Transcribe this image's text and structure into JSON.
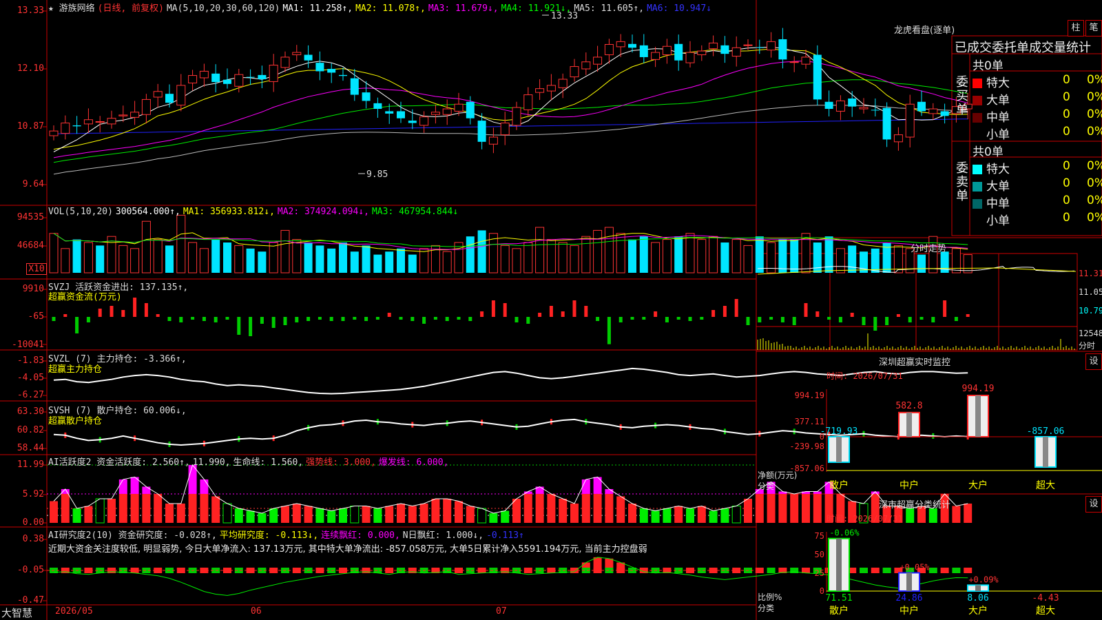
{
  "stock": {
    "name": "★ 游族网络",
    "period": "(日线, 前复权)",
    "ma_items": [
      {
        "t": "MA(5,10,20,30,60,120)",
        "c": "#dddddd"
      },
      {
        "t": "MA1: 11.258↑,",
        "c": "#ffffff"
      },
      {
        "t": "MA2: 11.078↑,",
        "c": "#ffff00"
      },
      {
        "t": "MA3: 11.679↓,",
        "c": "#ff00ff"
      },
      {
        "t": "MA4: 11.921↓,",
        "c": "#00ff00"
      },
      {
        "t": "MA5: 11.605↑,",
        "c": "#dddddd"
      },
      {
        "t": "MA6: 10.947↓",
        "c": "#3333ff"
      }
    ],
    "y_labels": [
      "13.33",
      "12.10",
      "10.87",
      "9.64"
    ],
    "high_label": "13.33",
    "low_label": "9.85"
  },
  "volume": {
    "items": [
      {
        "t": "VOL(5,10,20)",
        "c": "#dddddd"
      },
      {
        "t": "300564.000↑,",
        "c": "#ffffff"
      },
      {
        "t": "MA1: 356933.812↓,",
        "c": "#ffff00"
      },
      {
        "t": "MA2: 374924.094↓,",
        "c": "#ff00ff"
      },
      {
        "t": "MA3: 467954.844↓",
        "c": "#00ff00"
      }
    ],
    "y_labels": [
      "94535",
      "46684"
    ],
    "unit": "X10"
  },
  "svzj": {
    "line1": "SVZJ  活跃资金进出: 137.135↑,",
    "line2": "超赢资金流(万元)",
    "y_labels": [
      "9910",
      "-65",
      "-10041"
    ]
  },
  "svzl": {
    "line1": "SVZL (7) 主力持仓: -3.366↑,",
    "line2": "超赢主力持仓",
    "y_labels": [
      "-1.83",
      "-4.05",
      "-6.27"
    ]
  },
  "svsh": {
    "line1": "SVSH (7) 散户持仓: 60.006↓,",
    "line2": "超赢散户持仓",
    "y_labels": [
      "63.30",
      "60.82",
      "58.44"
    ]
  },
  "ai_active": {
    "items": [
      {
        "t": "AI活跃度2 资金活跃度: 2.560↑,",
        "c": "#dddddd"
      },
      {
        "t": "11.990,",
        "c": "#dddddd"
      },
      {
        "t": "生命线: 1.560,",
        "c": "#dddddd"
      },
      {
        "t": "强势线: 3.000,",
        "c": "#ff3333"
      },
      {
        "t": "爆发线: 6.000,",
        "c": "#ff00ff"
      }
    ],
    "y_labels": [
      "11.99",
      "5.92",
      "0.00"
    ]
  },
  "ai_research": {
    "items": [
      {
        "t": "AI研究度2(10) 资金研究度: -0.028↑,",
        "c": "#dddddd"
      },
      {
        "t": "平均研究度: -0.113↓,",
        "c": "#ffff00"
      },
      {
        "t": "连续飘红: 0.000,",
        "c": "#ff00ff"
      },
      {
        "t": "N日飘红: 1.000↓,",
        "c": "#dddddd"
      },
      {
        "t": "-0.113↑",
        "c": "#3333ff"
      }
    ],
    "comment": "近期大资金关注度较低, 明显弱势, 今日大单净流入: 137.13万元, 其中特大单净流出: -857.058万元, 大单5日累计净入5591.194万元, 当前主力控盘弱",
    "y_labels": [
      "0.38",
      "-0.05",
      "-0.47"
    ]
  },
  "xaxis": {
    "brand": "大智慧",
    "d1": "2026/05",
    "d2": "06",
    "d3": "07"
  },
  "right": {
    "title": "龙虎看盘(逐单)",
    "btn_bar": "柱",
    "btn_note": "笔",
    "header": "已成交委托单成交量统计",
    "buy_label": "委买单",
    "sell_label": "委卖单",
    "buy_total": "共0单",
    "sell_total": "共0单",
    "rows": [
      "特大",
      "大单",
      "中单",
      "小单"
    ],
    "row_val": "0",
    "row_pct": "0%",
    "buy_colors": [
      "#ff0000",
      "#990000",
      "#660000",
      "#000000"
    ],
    "sell_colors": [
      "#00ffff",
      "#009999",
      "#006666",
      "#000000"
    ],
    "intraday_title": "分时走势",
    "intraday_prices": [
      "11.31",
      "11.05",
      "10.79"
    ],
    "intraday_vol": "12548",
    "intraday_tab": "分时",
    "sz_title": "深圳超赢实时监控",
    "sz_time": "时间: 2026/07/31",
    "sz_btn": "设",
    "sz_y": [
      "994.19",
      "377.11",
      "0",
      "-239.98",
      "-857.06"
    ],
    "sz_vals": [
      "-719.93",
      "582.8",
      "994.19",
      "-857.06"
    ],
    "sz_axis": "净额(万元)",
    "sz_cat": "分类",
    "cats": [
      "散户",
      "中户",
      "大户",
      "超大"
    ],
    "cls_title": "深市超赢分类统计",
    "cls_time": "时间: 2026/07/31",
    "cls_btn": "设",
    "cls_y": [
      "75",
      "50",
      "25",
      "0"
    ],
    "cls_pct": [
      "-0.06%",
      "+0.05%",
      "+0.09%"
    ],
    "cls_vals": [
      "71.51",
      "24.86",
      "8.06",
      "-4.43"
    ],
    "cls_axis": "比例%",
    "cls_cat": "分类"
  },
  "chart_data": [
    {
      "type": "candlestick",
      "title": "游族网络 日线",
      "x": [
        "2026/05",
        "06",
        "07"
      ],
      "ylim": [
        9.64,
        13.33
      ],
      "high": 13.33,
      "low": 9.85,
      "closes": [
        10.78,
        10.95,
        10.88,
        11.02,
        10.98,
        11.05,
        11.12,
        11.18,
        11.45,
        11.62,
        11.38,
        11.75,
        11.96,
        12.05,
        11.82,
        11.78,
        11.98,
        11.92,
        11.88,
        12.18,
        12.35,
        12.45,
        12.28,
        12.05,
        12.02,
        11.95,
        11.55,
        11.42,
        11.25,
        11.15,
        11.05,
        10.95,
        11.08,
        11.18,
        11.25,
        11.35,
        11.05,
        10.55,
        10.65,
        10.95,
        11.28,
        11.55,
        11.68,
        11.75,
        11.88,
        12.15,
        12.25,
        12.35,
        12.62,
        12.68,
        12.55,
        12.35,
        12.45,
        12.58,
        12.28,
        12.45,
        12.48,
        12.65,
        12.42,
        12.55,
        12.61,
        12.55,
        12.68,
        12.3,
        12.25,
        12.35,
        11.45,
        11.25,
        11.42,
        11.3,
        11.28,
        11.22,
        10.6,
        10.7,
        11.35,
        11.2,
        11.25,
        11.1,
        11.3,
        11.35
      ],
      "ma": {
        "MA1": 11.258,
        "MA2": 11.078,
        "MA3": 11.679,
        "MA4": 11.921,
        "MA5": 11.605,
        "MA6": 10.947
      }
    },
    {
      "type": "bar",
      "title": "VOL(5,10,20)",
      "values": [
        13,
        8,
        11,
        10,
        9,
        12,
        9,
        8,
        17,
        11,
        9,
        19,
        10,
        8,
        11,
        10,
        9,
        8,
        7,
        10,
        14,
        11,
        10,
        9,
        8,
        10,
        7,
        9,
        6,
        7,
        8,
        6,
        8,
        9,
        7,
        10,
        12,
        14,
        13,
        9,
        8,
        10,
        15,
        11,
        10,
        9,
        12,
        14,
        15,
        13,
        11,
        12,
        10,
        11,
        12,
        13,
        11,
        12,
        10,
        11,
        9,
        12,
        10,
        11,
        11,
        13,
        10,
        12,
        8,
        9,
        7,
        8,
        10,
        9,
        8,
        6,
        12,
        7,
        8,
        6
      ],
      "MA1": 356933.812,
      "MA2": 374924.094,
      "MA3": 467954.844
    },
    {
      "type": "bar",
      "title": "SVZJ 活跃资金进出",
      "values": [
        -1500,
        1000,
        -6000,
        -2000,
        3000,
        4000,
        2500,
        7000,
        5000,
        1000,
        -1500,
        -2000,
        -1000,
        -1500,
        -2000,
        -1000,
        -6500,
        -7000,
        -2500,
        -4000,
        -3000,
        -2000,
        -1500,
        -1000,
        -1500,
        -1500,
        -1000,
        -1500,
        -1000,
        1500,
        -1000,
        -1500,
        -2500,
        -1000,
        -1500,
        -1000,
        -1500,
        2000,
        6000,
        5000,
        -2000,
        -2500,
        1500,
        4000,
        2000,
        6000,
        4000,
        -1500,
        -9910,
        -2000,
        -1000,
        -1000,
        2000,
        -2000,
        -1000,
        -1500,
        -1000,
        2500,
        4000,
        6500,
        -3000,
        -2000,
        -1000,
        -2000,
        -3000,
        5000,
        2000,
        -1000,
        -2000,
        1500,
        -3000,
        -5000,
        -3000,
        1000,
        -2000,
        -1000,
        -2000,
        6000,
        -1500,
        1000
      ],
      "last": 137.135
    },
    {
      "type": "line",
      "title": "SVZL 主力持仓",
      "ylim": [
        -6.27,
        -1.83
      ],
      "values": [
        -4.3,
        -4.2,
        -4.5,
        -4.6,
        -4.4,
        -4.2,
        -3.9,
        -3.7,
        -3.6,
        -3.7,
        -3.9,
        -4.2,
        -4.4,
        -4.5,
        -4.8,
        -5.0,
        -4.9,
        -5.0,
        -5.1,
        -5.3,
        -5.5,
        -5.7,
        -5.9,
        -6.0,
        -6.05,
        -6.0,
        -5.9,
        -5.8,
        -5.7,
        -5.6,
        -5.5,
        -5.3,
        -5.1,
        -4.8,
        -4.5,
        -4.2,
        -3.9,
        -3.6,
        -3.3,
        -3.2,
        -3.4,
        -3.7,
        -4.0,
        -4.1,
        -4.0,
        -3.8,
        -3.6,
        -3.4,
        -3.2,
        -3.0,
        -2.8,
        -2.9,
        -3.1,
        -3.3,
        -3.6,
        -3.7,
        -3.6,
        -3.5,
        -3.7,
        -3.9,
        -3.8,
        -3.7,
        -3.5,
        -3.3,
        -3.2,
        -3.3,
        -3.5,
        -3.6,
        -3.7,
        -3.5,
        -3.3,
        -3.2,
        -3.4,
        -3.5,
        -3.3,
        -3.2,
        -3.2,
        -3.3,
        -3.4,
        -3.366
      ],
      "last": -3.366
    },
    {
      "type": "line",
      "title": "SVSH 散户持仓",
      "ylim": [
        58.44,
        63.3
      ],
      "values": [
        60.3,
        60.2,
        59.8,
        59.5,
        59.6,
        59.8,
        60.1,
        59.8,
        59.5,
        59.2,
        59.0,
        58.9,
        59.0,
        59.1,
        59.3,
        59.5,
        59.7,
        59.8,
        59.7,
        59.8,
        60.2,
        60.8,
        61.2,
        61.5,
        61.6,
        61.8,
        62.1,
        62.2,
        62.0,
        61.9,
        61.7,
        61.6,
        61.5,
        61.7,
        61.8,
        62.0,
        62.1,
        61.9,
        61.7,
        61.5,
        61.3,
        61.4,
        61.7,
        62.0,
        62.2,
        62.3,
        62.0,
        61.8,
        61.6,
        61.3,
        61.2,
        61.4,
        61.5,
        61.6,
        61.5,
        61.3,
        61.1,
        61.0,
        60.7,
        60.5,
        60.3,
        60.4,
        60.6,
        60.8,
        60.7,
        60.5,
        60.4,
        60.3,
        60.2,
        60.3,
        60.4,
        60.2,
        60.1,
        60.0,
        60.1,
        60.2,
        60.1,
        60.0,
        60.1,
        60.006
      ],
      "last": 60.006
    },
    {
      "type": "bar",
      "title": "AI活跃度2 资金活跃度",
      "ylim": [
        0,
        11.99
      ],
      "values": [
        4.5,
        7.0,
        3.0,
        3.5,
        5.0,
        5.0,
        9.0,
        9.5,
        7.5,
        6.0,
        4.0,
        4.0,
        12.0,
        9.0,
        5.5,
        4.0,
        3.0,
        2.5,
        2.0,
        3.0,
        3.5,
        4.0,
        3.5,
        3.0,
        2.5,
        3.0,
        3.5,
        3.5,
        3.0,
        3.5,
        4.0,
        3.5,
        4.0,
        5.0,
        5.0,
        4.5,
        3.5,
        3.0,
        2.0,
        2.5,
        5.0,
        6.5,
        7.5,
        6.0,
        5.0,
        4.0,
        9.0,
        9.5,
        7.0,
        5.5,
        4.0,
        3.0,
        2.5,
        3.0,
        3.5,
        3.0,
        3.5,
        2.5,
        3.0,
        3.5,
        5.0,
        7.0,
        8.5,
        6.5,
        6.0,
        6.5,
        6.5,
        8.5,
        6.0,
        4.5,
        4.0,
        6.5,
        3.5,
        3.5,
        3.0,
        3.5,
        3.0,
        6.0,
        3.5,
        4.0
      ],
      "levels": {
        "生命线": 1.56,
        "强势线": 3.0,
        "爆发线": 6.0,
        "max": 11.99
      },
      "last": 2.56
    },
    {
      "type": "line",
      "title": "AI研究度2(10) 资金研究度",
      "ylim": [
        -0.47,
        0.38
      ],
      "values": [
        -0.03,
        -0.02,
        -0.05,
        -0.06,
        -0.04,
        -0.02,
        -0.03,
        -0.04,
        -0.06,
        -0.08,
        -0.12,
        -0.18,
        -0.25,
        -0.32,
        -0.36,
        -0.38,
        -0.35,
        -0.3,
        -0.26,
        -0.22,
        -0.18,
        -0.15,
        -0.12,
        -0.09,
        -0.07,
        -0.05,
        -0.03,
        -0.02,
        -0.04,
        -0.06,
        -0.03,
        -0.02,
        -0.04,
        -0.03,
        -0.02,
        -0.06,
        -0.05,
        -0.04,
        -0.03,
        -0.02,
        -0.04,
        -0.06,
        -0.05,
        -0.04,
        -0.03,
        -0.02,
        0.12,
        0.2,
        0.18,
        0.12,
        0.05,
        -0.02,
        -0.04,
        -0.03,
        -0.05,
        -0.07,
        -0.1,
        -0.12,
        -0.14,
        -0.12,
        -0.1,
        -0.08,
        -0.06,
        -0.03,
        -0.02,
        -0.04,
        -0.05,
        -0.07,
        -0.1,
        -0.14,
        -0.18,
        -0.22,
        -0.25,
        -0.27,
        -0.24,
        -0.2,
        -0.16,
        -0.13,
        -0.11,
        -0.113
      ],
      "last": -0.028,
      "avg": -0.113
    },
    {
      "type": "bar",
      "title": "深圳超赢实时监控",
      "categories": [
        "散户",
        "中户",
        "大户",
        "超大"
      ],
      "values": [
        -719.93,
        582.8,
        994.19,
        -857.06
      ],
      "ylim": [
        -857.06,
        994.19
      ]
    },
    {
      "type": "bar",
      "title": "深市超赢分类统计",
      "categories": [
        "散户",
        "中户",
        "大户",
        "超大"
      ],
      "values": [
        71.51,
        24.86,
        8.06,
        -4.43
      ],
      "changes": [
        "-0.06%",
        "+0.05%",
        "+0.09%",
        ""
      ],
      "ylim": [
        0,
        75
      ]
    }
  ]
}
